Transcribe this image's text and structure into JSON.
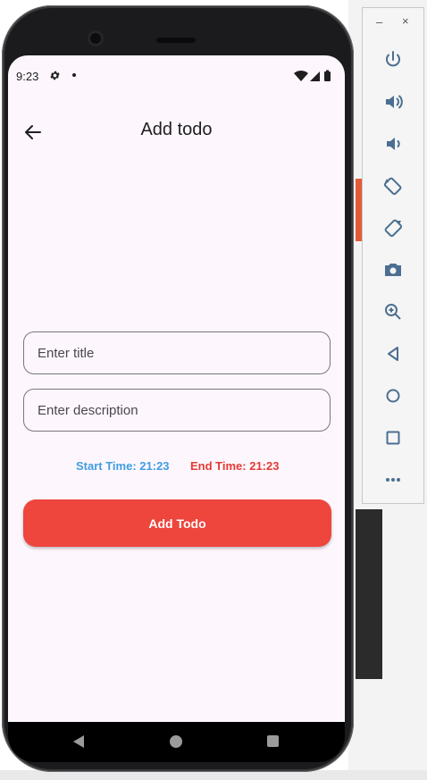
{
  "status_bar": {
    "time": "9:23",
    "icons": [
      "settings-icon",
      "notification-dot-icon",
      "wifi-icon",
      "signal-icon",
      "battery-icon"
    ]
  },
  "app_bar": {
    "title": "Add todo",
    "back_icon": "arrow-back-icon"
  },
  "form": {
    "title_placeholder": "Enter title",
    "title_value": "",
    "description_placeholder": "Enter description",
    "description_value": ""
  },
  "times": {
    "start": "Start Time: 21:23",
    "end": "End Time: 21:23"
  },
  "add_button": {
    "label": "Add Todo"
  },
  "nav_bar": {
    "icons": [
      "nav-back-icon",
      "nav-home-icon",
      "nav-recents-icon"
    ]
  },
  "emulator_toolbar": {
    "window_controls": {
      "minimize": "–",
      "close": "×"
    },
    "buttons": [
      "power-icon",
      "volume-up-icon",
      "volume-down-icon",
      "rotate-left-icon",
      "rotate-right-icon",
      "camera-icon",
      "zoom-icon",
      "back-icon",
      "home-icon",
      "overview-icon",
      "more-icon"
    ]
  },
  "colors": {
    "screen_bg": "#fdf7fd",
    "accent_button": "#ee453d",
    "start_time": "#3f9de0",
    "end_time": "#e53935"
  }
}
